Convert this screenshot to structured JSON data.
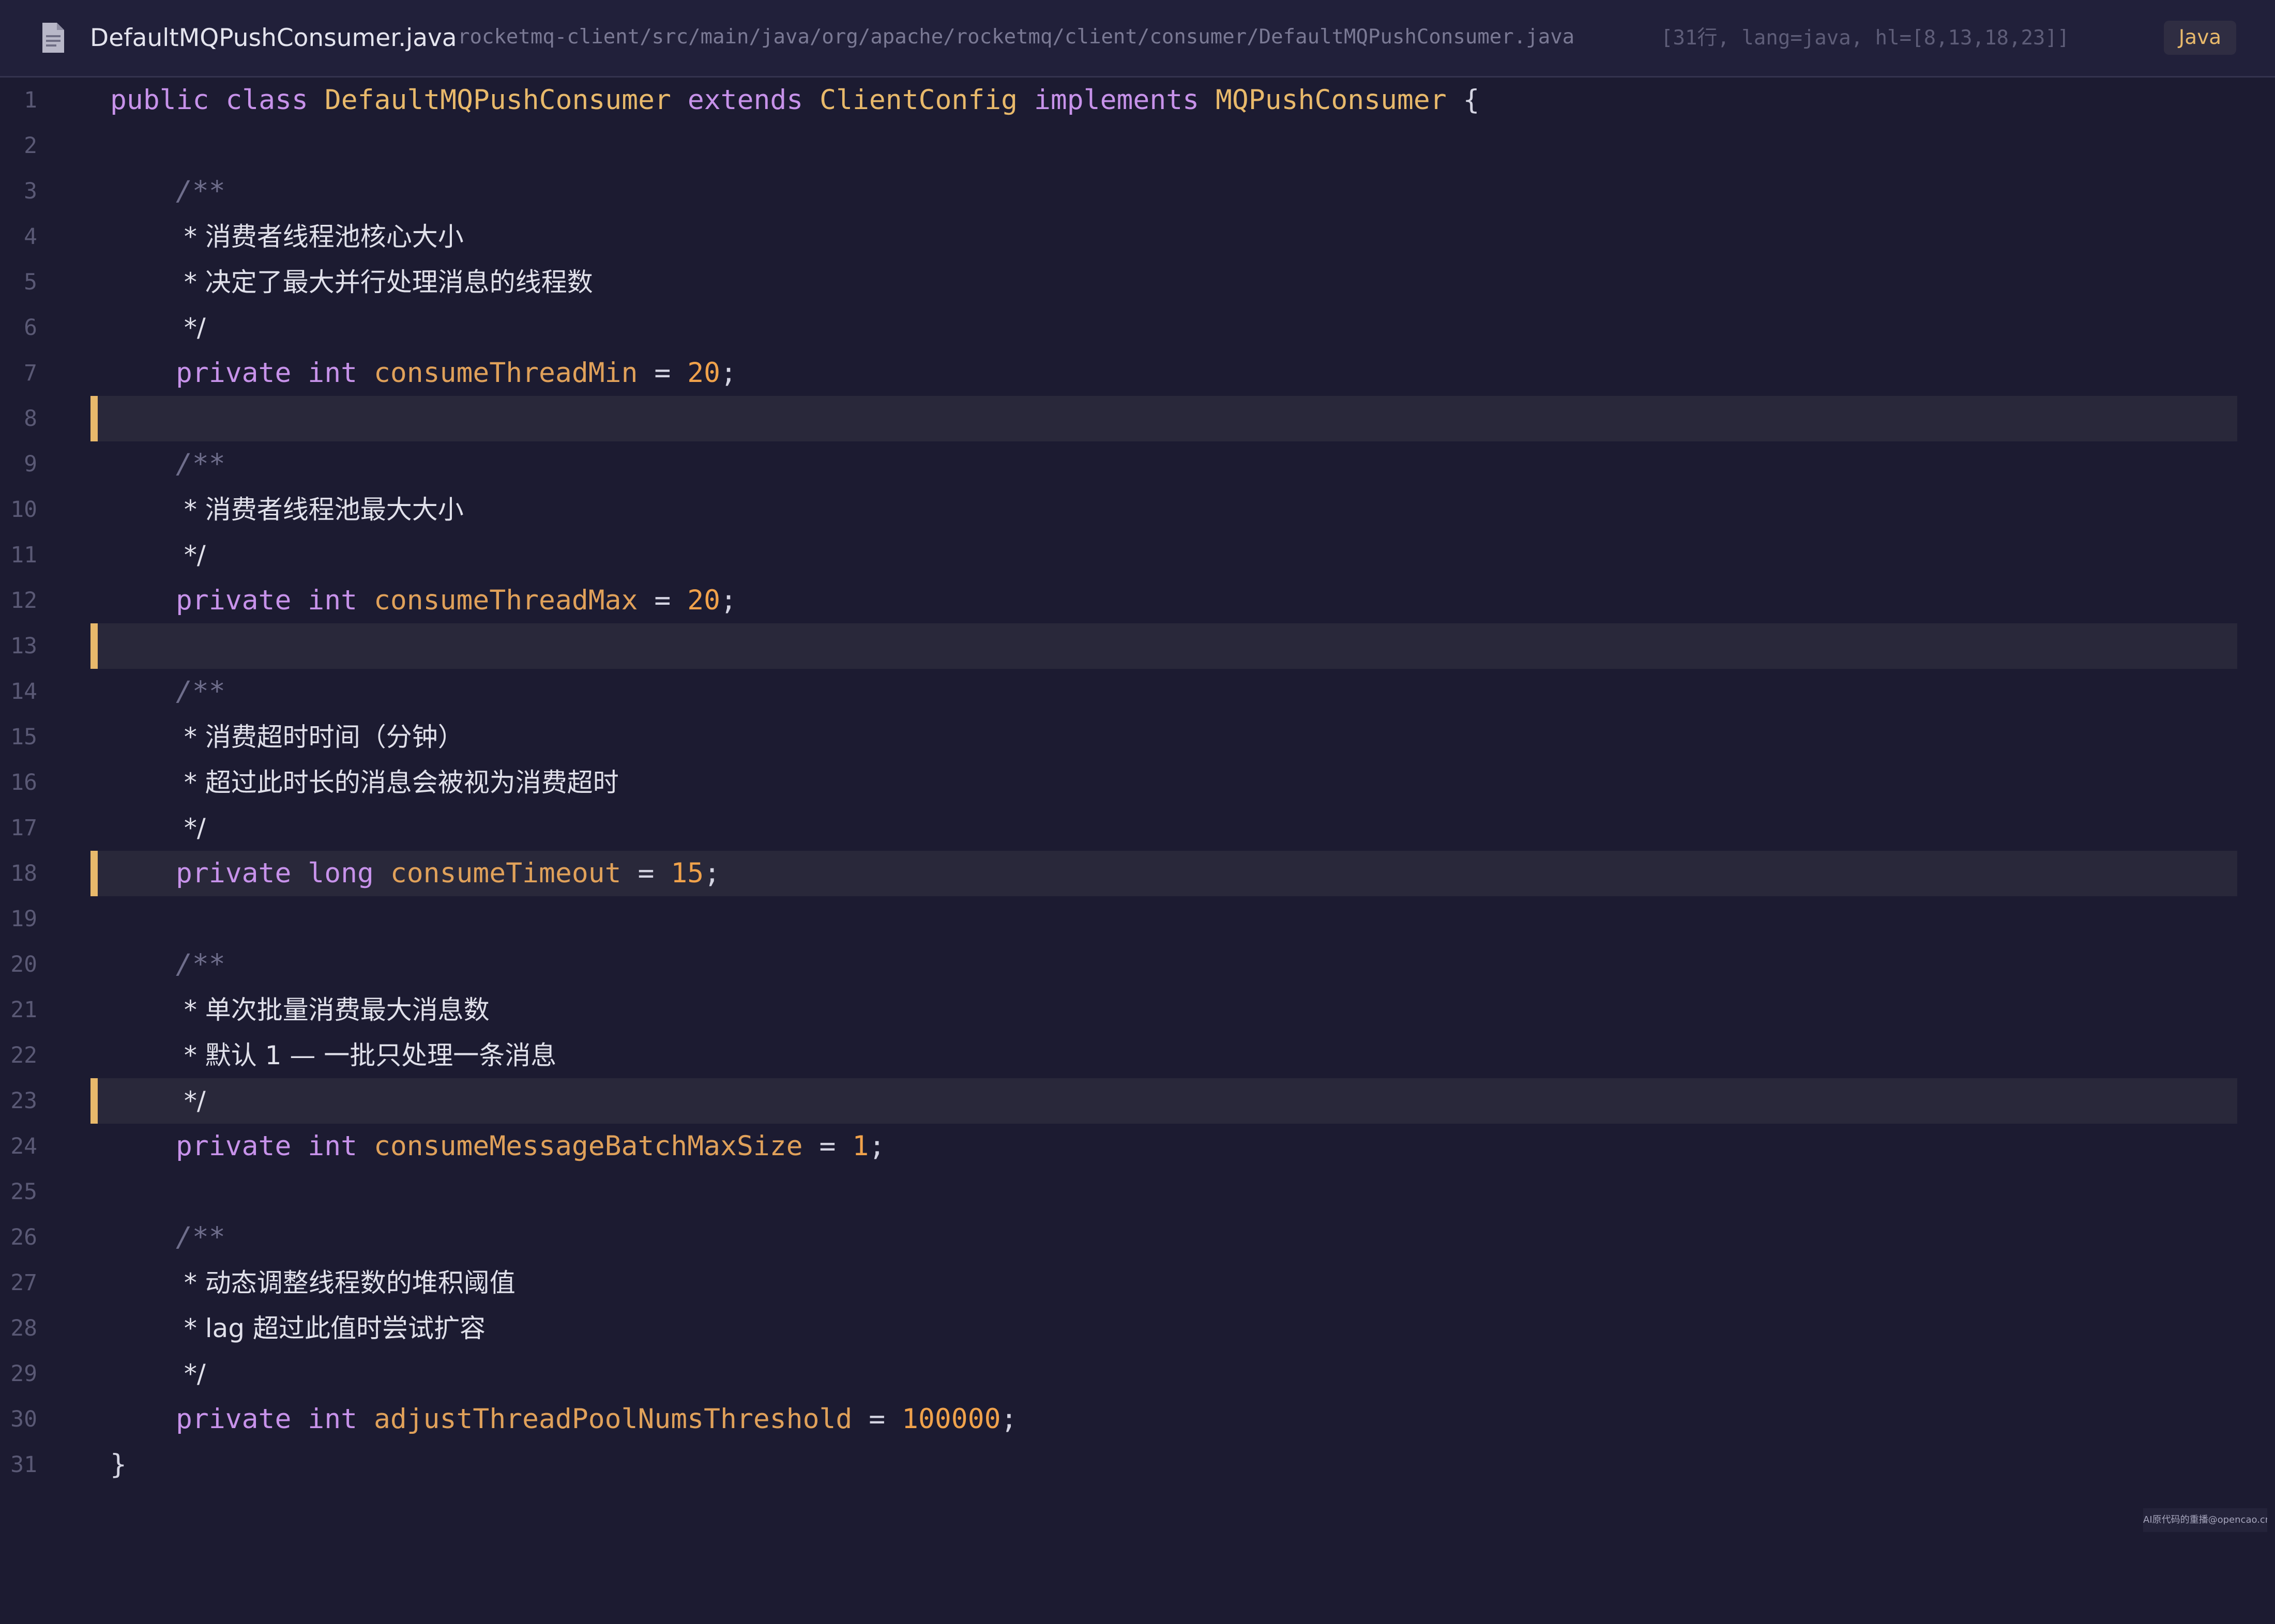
{
  "header": {
    "filename": "DefaultMQPushConsumer.java",
    "path": "rocketmq-client/src/main/java/org/apache/rocketmq/client/consumer/DefaultMQPushConsumer.java",
    "meta": "[31行, lang=java, hl=[8,13,18,23]]",
    "language": "Java",
    "icon": "document-icon"
  },
  "highlighted_lines": [
    8,
    13,
    18,
    23
  ],
  "lines": [
    {
      "n": "1",
      "t": ""
    },
    {
      "n": "2",
      "t": ""
    },
    {
      "n": "3",
      "t": "/**"
    },
    {
      "n": "4",
      "t": " * 消费者线程池核心大小"
    },
    {
      "n": "5",
      "t": " * 决定了最大并行处理消息的线程数"
    },
    {
      "n": "6",
      "t": " */"
    },
    {
      "n": "7",
      "t": ""
    },
    {
      "n": "8",
      "t": ""
    },
    {
      "n": "9",
      "t": "/**"
    },
    {
      "n": "10",
      "t": " * 消费者线程池最大大小"
    },
    {
      "n": "11",
      "t": " */"
    },
    {
      "n": "12",
      "t": ""
    },
    {
      "n": "13",
      "t": ""
    },
    {
      "n": "14",
      "t": "/**"
    },
    {
      "n": "15",
      "t": " * 消费超时时间（分钟）"
    },
    {
      "n": "16",
      "t": " * 超过此时长的消息会被视为消费超时"
    },
    {
      "n": "17",
      "t": " */"
    },
    {
      "n": "18",
      "t": ""
    },
    {
      "n": "19",
      "t": ""
    },
    {
      "n": "20",
      "t": "/**"
    },
    {
      "n": "21",
      "t": " * 单次批量消费最大消息数"
    },
    {
      "n": "22",
      "t": " * 默认 1 — 一批只处理一条消息"
    },
    {
      "n": "23",
      "t": " */"
    },
    {
      "n": "24",
      "t": ""
    },
    {
      "n": "25",
      "t": ""
    },
    {
      "n": "26",
      "t": "/**"
    },
    {
      "n": "27",
      "t": " * 动态调整线程数的堆积阈值"
    },
    {
      "n": "28",
      "t": " * lag 超过此值时尝试扩容"
    },
    {
      "n": "29",
      "t": " */"
    },
    {
      "n": "30",
      "t": ""
    },
    {
      "n": "31",
      "t": "}"
    }
  ],
  "code": {
    "l1": {
      "public": "public",
      "class": "class",
      "name": "DefaultMQPushConsumer",
      "extends": "extends",
      "parent": "ClientConfig",
      "implements": "implements",
      "iface": "MQPushConsumer",
      "brace": "{"
    },
    "l7": {
      "mod": "private",
      "type": "int",
      "name": "consumeThreadMin",
      "op": "=",
      "val": "20",
      "end": ";"
    },
    "l12": {
      "mod": "private",
      "type": "int",
      "name": "consumeThreadMax",
      "op": "=",
      "val": "20",
      "end": ";"
    },
    "l18": {
      "mod": "private",
      "type": "long",
      "name": "consumeTimeout",
      "op": "=",
      "val": "15",
      "end": ";"
    },
    "l24": {
      "mod": "private",
      "type": "int",
      "name": "consumeMessageBatchMaxSize",
      "op": "=",
      "val": "1",
      "end": ";"
    },
    "l30": {
      "mod": "private",
      "type": "int",
      "name": "adjustThreadPoolNumsThreshold",
      "op": "=",
      "val": "100000",
      "end": ";"
    }
  },
  "watermark": "AI原代码的重播@opencao.cn"
}
